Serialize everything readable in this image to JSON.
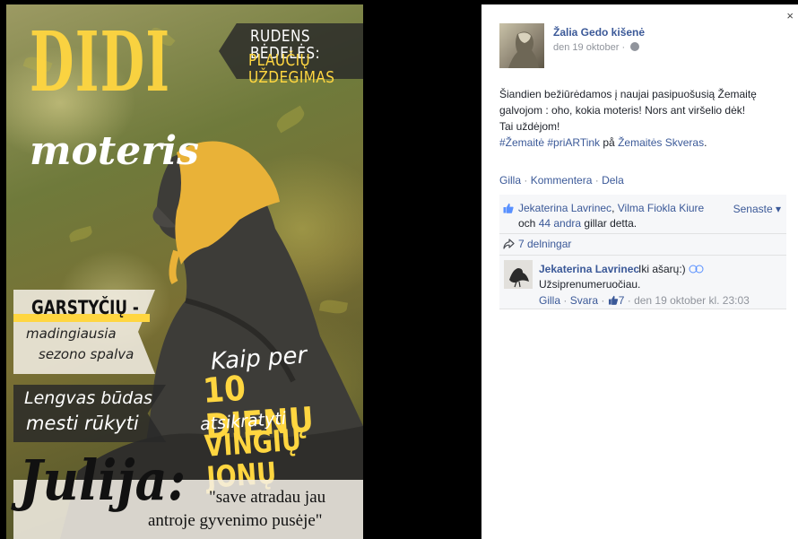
{
  "cover": {
    "headline": "DIDI",
    "headline_sub": "moteris",
    "rudens": {
      "title": "RUDENS BĖDELĖS:",
      "sub": "PLAUČIŲ UŽDEGIMAS"
    },
    "garst": {
      "title": "GARSTYČIŲ -",
      "line1": "madingiausia",
      "line2": "sezono spalva"
    },
    "lengvas": {
      "line1": "Lengvas būdas",
      "line2": "mesti rūkyti"
    },
    "kaip": {
      "line1": "Kaip per",
      "line2": "10 DIENŲ",
      "line3": "atsikratyti",
      "line4": "VINGIŲ JONŲ"
    },
    "julija": {
      "name": "Julija:",
      "quote1": "\"save atradau jau",
      "quote2": "antroje gyvenimo pusėje\""
    },
    "colors": {
      "accent": "#ffd640",
      "banner_dark": "#282828",
      "banner_light": "#f5f0e6"
    }
  },
  "post": {
    "close_label": "×",
    "page_name": "Žalia Gedo kišenė",
    "date": "den 19 oktober",
    "date_separator": " · ",
    "text_line1": "Šiandien bežiūrėdamos į naujai pasipuošusią Žemaitę",
    "text_line2": "galvojom : oho, kokia moteris! Nors ant viršelio dėk!",
    "text_line3": "Tai uždėjom!",
    "hashtags": "#Žemaitė #priARTink",
    "place_prefix": " på ",
    "place": "Žemaitės Skveras",
    "place_suffix": ".",
    "actions": {
      "like": "Gilla",
      "comment": "Kommentera",
      "share": "Dela",
      "separator": " · "
    },
    "likes": {
      "person1": "Jekaterina Lavrinec",
      "comma": ", ",
      "person2": "Vilma Fiokla Kiure",
      "and": "och ",
      "others": "44 andra",
      "suffix": " gillar detta.",
      "sort": "Senaste ▾"
    },
    "shares": "7 delningar",
    "comment": {
      "author": "Jekaterina Lavrinec",
      "text": "Iki ašarų:)",
      "text2": "Užsiprenumeruočiau.",
      "like": "Gilla",
      "reply": "Svara",
      "like_count": "7",
      "time": "den 19 oktober kl. 23:03",
      "separator": " · "
    },
    "colors": {
      "link": "#3b5998",
      "meta": "#90949c",
      "ufi_bg": "#f6f7f9"
    }
  }
}
